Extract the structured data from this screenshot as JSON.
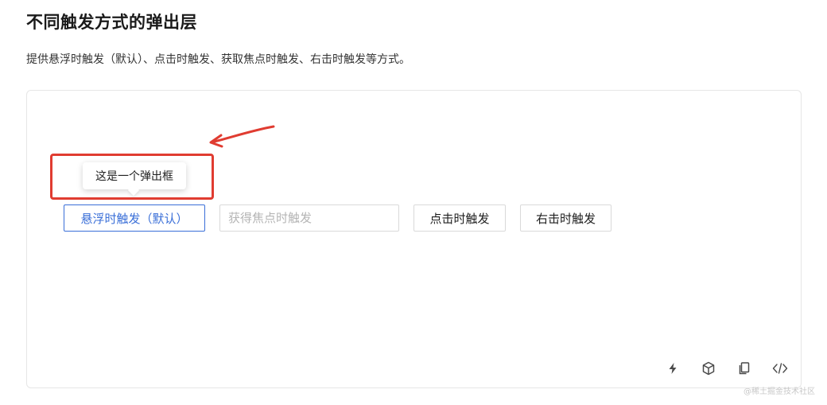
{
  "header": {
    "title": "不同触发方式的弹出层",
    "description": "提供悬浮时触发（默认）、点击时触发、获取焦点时触发、右击时触发等方式。"
  },
  "demo": {
    "popover_text": "这是一个弹出框",
    "hover_button_label": "悬浮时触发（默认）",
    "focus_input_placeholder": "获得焦点时触发",
    "click_button_label": "点击时触发",
    "context_button_label": "右击时触发",
    "accent_color": "#3a6fd8",
    "annotation_color": "#e03c31"
  },
  "toolbar": {
    "icons": [
      "lightning-icon",
      "cube-icon",
      "copy-icon",
      "code-icon"
    ]
  },
  "watermark": "@稀土掘金技术社区"
}
